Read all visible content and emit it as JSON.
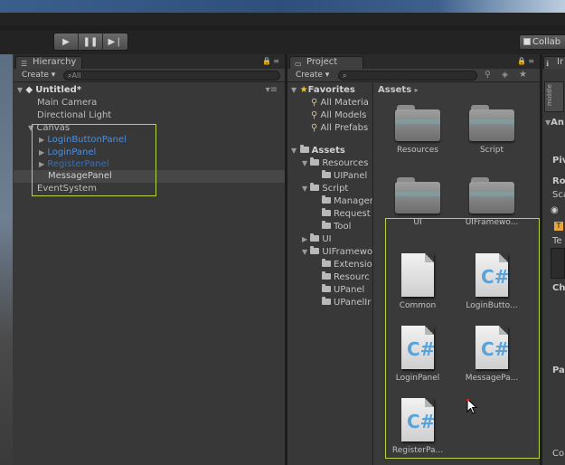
{
  "toolbar": {
    "play_icon": "play-icon",
    "pause_icon": "pause-icon",
    "step_icon": "step-icon",
    "collab_label": "Collab"
  },
  "hierarchy": {
    "tab_label": "Hierarchy",
    "create_label": "Create ▾",
    "search_placeholder": "All",
    "scene_name": "Untitled*",
    "items": [
      {
        "label": "Main Camera"
      },
      {
        "label": "Directional Light"
      },
      {
        "label": "Canvas"
      },
      {
        "label": "LoginButtonPanel"
      },
      {
        "label": "LoginPanel"
      },
      {
        "label": "RegisterPanel"
      },
      {
        "label": "MessagePanel"
      },
      {
        "label": "EventSystem"
      }
    ]
  },
  "project": {
    "tab_label": "Project",
    "create_label": "Create ▾",
    "breadcrumb": "Assets",
    "favorites": {
      "label": "Favorites",
      "items": [
        "All Materia",
        "All Models",
        "All Prefabs"
      ]
    },
    "tree": {
      "root": "Assets",
      "items": [
        "Resources",
        "UIPanel",
        "Script",
        "Manager",
        "Request",
        "Tool",
        "UI",
        "UIFramewo",
        "Extensio",
        "Resourc",
        "UPanel",
        "UPanelIr"
      ]
    },
    "grid": [
      {
        "label": "Resources",
        "kind": "folder"
      },
      {
        "label": "Script",
        "kind": "folder"
      },
      {
        "label": "UI",
        "kind": "folder"
      },
      {
        "label": "UIFramewo...",
        "kind": "folder"
      },
      {
        "label": "Common",
        "kind": "doc"
      },
      {
        "label": "LoginButto...",
        "kind": "cs"
      },
      {
        "label": "LoginPanel",
        "kind": "cs"
      },
      {
        "label": "MessagePa...",
        "kind": "cs"
      },
      {
        "label": "RegisterPa...",
        "kind": "cs"
      }
    ],
    "cs_glyph": "C#"
  },
  "inspector": {
    "tab_label": "Ir",
    "labels": [
      "middle",
      "An",
      "Piv",
      "Ro",
      "Sca",
      "Te",
      "Ch",
      "Pa",
      "Co"
    ]
  },
  "colors": {
    "highlight_box": "#b6d63e",
    "prefab_blue": "#4b8fe4",
    "panel_bg": "#383838"
  }
}
